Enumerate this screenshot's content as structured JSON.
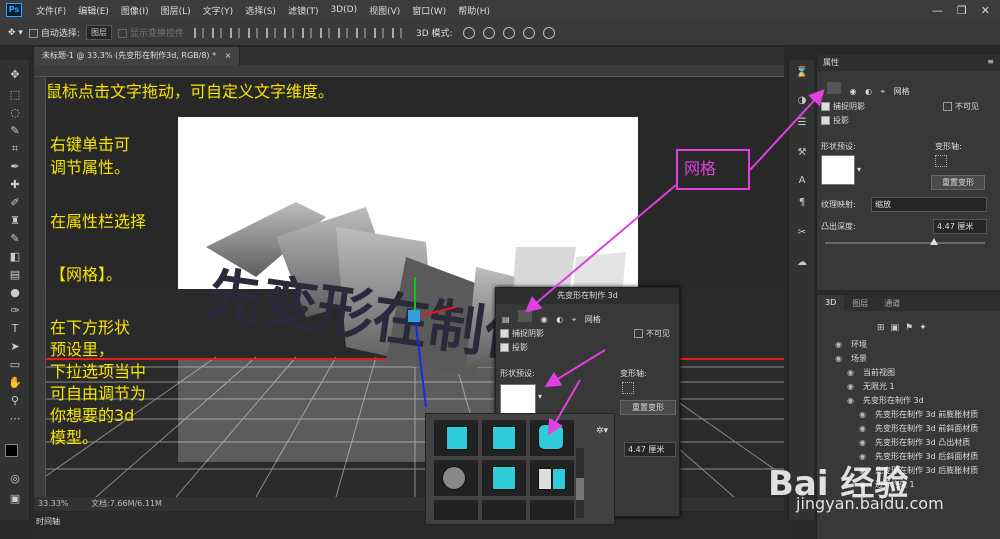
{
  "menu": {
    "app_icon": "Ps",
    "items": [
      "文件(F)",
      "编辑(E)",
      "图像(I)",
      "图层(L)",
      "文字(Y)",
      "选择(S)",
      "滤镜(T)",
      "3D(D)",
      "视图(V)",
      "窗口(W)",
      "帮助(H)"
    ],
    "window_controls": [
      "—",
      "❐",
      "✕"
    ]
  },
  "options": {
    "auto_select": "自动选择:",
    "auto_select_value": "图层",
    "show_transform": "显示变换控件",
    "mode_3d": "3D 模式:"
  },
  "document": {
    "tab_title": "未标题-1 @ 33.3% (先变形在制作3d, RGB/8) *",
    "zoom": "33.33%",
    "doc_size": "文档:7.66M/6.11M",
    "timeline": "时间轴",
    "scene_text": "先变形在制作3d"
  },
  "annotations": {
    "line1": "鼠标点击文字拖动，可自定义文字维度。",
    "line2a": "右键单击可",
    "line2b": "调节属性。",
    "line3": "在属性栏选择",
    "line4": "【网格】。",
    "line5a": "在下方形状",
    "line5b": "预设里，",
    "line5c": "下拉选项当中",
    "line5d": "可自由调节为",
    "line5e": "你想要的3d",
    "line5f": "模型。",
    "callout": "网格"
  },
  "properties_panel": {
    "title": "属性",
    "tab_mesh": "网格",
    "capture_shadows": "捕捉阴影",
    "invisible": "不可见",
    "cast_shadows": "投影",
    "shape_preset": "形状预设:",
    "deform_axis": "变形轴:",
    "reset_deform": "重置变形",
    "texture_map": "纹理映射:",
    "texture_map_value": "缩放",
    "extrusion_depth": "凸出深度:",
    "extrusion_value": "4.47 厘米",
    "slider_position": 0.68
  },
  "floating_props": {
    "title": "先变形在制作 3d",
    "tab_mesh": "网格",
    "capture_shadows": "捕捉阴影",
    "invisible": "不可见",
    "cast_shadows": "投影",
    "shape_preset": "形状预设:",
    "deform_axis": "变形轴:",
    "reset_deform": "重置变形",
    "extrusion_value": "4.47 厘米"
  },
  "layers_3d": {
    "tabs": [
      "3D",
      "图层",
      "通道"
    ],
    "items": [
      {
        "label": "环境",
        "indent": 1
      },
      {
        "label": "场景",
        "indent": 1
      },
      {
        "label": "当前视图",
        "indent": 2
      },
      {
        "label": "无限光 1",
        "indent": 2
      },
      {
        "label": "先变形在制作 3d",
        "indent": 2
      },
      {
        "label": "先变形在制作 3d 前膨胀材质",
        "indent": 3
      },
      {
        "label": "先变形在制作 3d 前斜面材质",
        "indent": 3
      },
      {
        "label": "先变形在制作 3d 凸出材质",
        "indent": 3
      },
      {
        "label": "先变形在制作 3d 后斜面材质",
        "indent": 3
      },
      {
        "label": "先变形在制作 3d 后膨胀材质",
        "indent": 3
      },
      {
        "label": "边界约束 1",
        "indent": 3
      }
    ]
  },
  "watermark": {
    "brand": "Bai 经验",
    "url": "jingyan.baidu.com"
  },
  "colors": {
    "annotation_text": "#f5e600",
    "callout": "#e040e0",
    "accent": "#31a8ff"
  }
}
